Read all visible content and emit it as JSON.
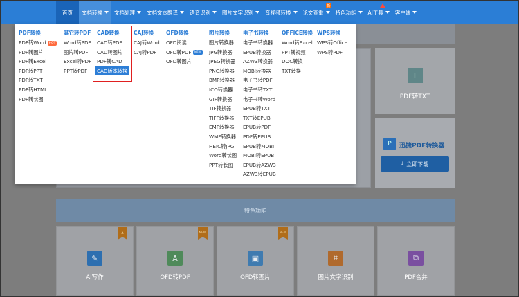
{
  "nav": {
    "items": [
      {
        "label": "首页"
      },
      {
        "label": "文档转换"
      },
      {
        "label": "文档处理"
      },
      {
        "label": "文档文本翻译"
      },
      {
        "label": "语音识别"
      },
      {
        "label": "图片文字识别"
      },
      {
        "label": "音视频转换"
      },
      {
        "label": "论文查重"
      },
      {
        "label": "特色功能"
      },
      {
        "label": "AI工具"
      },
      {
        "label": "客户端"
      }
    ],
    "new_badge": "新"
  },
  "dropdown": {
    "columns": [
      {
        "header": "PDF转换",
        "items": [
          "PDF转Word",
          "PDF转图片",
          "PDF转Excel",
          "PDF转PPT",
          "PDF转TXT",
          "PDF转HTML",
          "PDF转长图"
        ],
        "hot_tag": "HOT"
      },
      {
        "header": "其它转PDF",
        "items": [
          "Word转PDF",
          "图片转PDF",
          "Excel转PDF",
          "PPT转PDF"
        ]
      },
      {
        "header": "CAD转换",
        "items": [
          "CAD转PDF",
          "CAD转图片",
          "PDF转CAD",
          "CAD版本转换"
        ]
      },
      {
        "header": "CAJ转换",
        "items": [
          "CAJ转Word",
          "CAJ转PDF"
        ]
      },
      {
        "header": "OFD转换",
        "items": [
          "OFD阅读",
          "OFD转PDF",
          "OFD转图片"
        ],
        "new_tag": "NEW"
      },
      {
        "header": "图片转换",
        "items": [
          "图片转换器",
          "JPG转换器",
          "JPEG转换器",
          "PNG转换器",
          "BMP转换器",
          "ICO转换器",
          "GIF转换器",
          "TIF转换器",
          "TIFF转换器",
          "EMF转换器",
          "WMF转换器",
          "HEIC转JPG",
          "Word转长图",
          "PPT转长图"
        ]
      },
      {
        "header": "电子书转换",
        "items": [
          "电子书转换器",
          "EPUB转换器",
          "AZW3转换器",
          "MOBI转换器",
          "电子书转PDF",
          "电子书转TXT",
          "电子书转Word",
          "EPUB转TXT",
          "TXT转EPUB",
          "EPUB转PDF",
          "PDF转EPUB",
          "EPUB转MOBI",
          "MOBI转EPUB",
          "EPUB转AZW3",
          "AZW3转EPUB"
        ]
      },
      {
        "header": "OFFICE转换",
        "items": [
          "Word转Excel",
          "PPT转视频",
          "DOC转换",
          "TXT转换"
        ]
      },
      {
        "header": "WPS转换",
        "items": [
          "WPS转Office",
          "WPS转PDF"
        ]
      }
    ]
  },
  "background": {
    "pdf_txt_card": "PDF转TXT",
    "ad": {
      "name": "迅捷PDF转换器",
      "download": "立即下载"
    },
    "features_title": "特色功能",
    "tools": [
      {
        "label": "AI写作",
        "ribbon": "HOT",
        "color": "#2d6fb0"
      },
      {
        "label": "OFD转PDF",
        "ribbon": "NEW",
        "color": "#4f8a5a"
      },
      {
        "label": "OFD转图片",
        "ribbon": "NEW",
        "color": "#3f7bb0"
      },
      {
        "label": "图片文字识别",
        "color": "#b06a2d"
      },
      {
        "label": "PDF合并",
        "color": "#7a4fa0"
      }
    ]
  }
}
